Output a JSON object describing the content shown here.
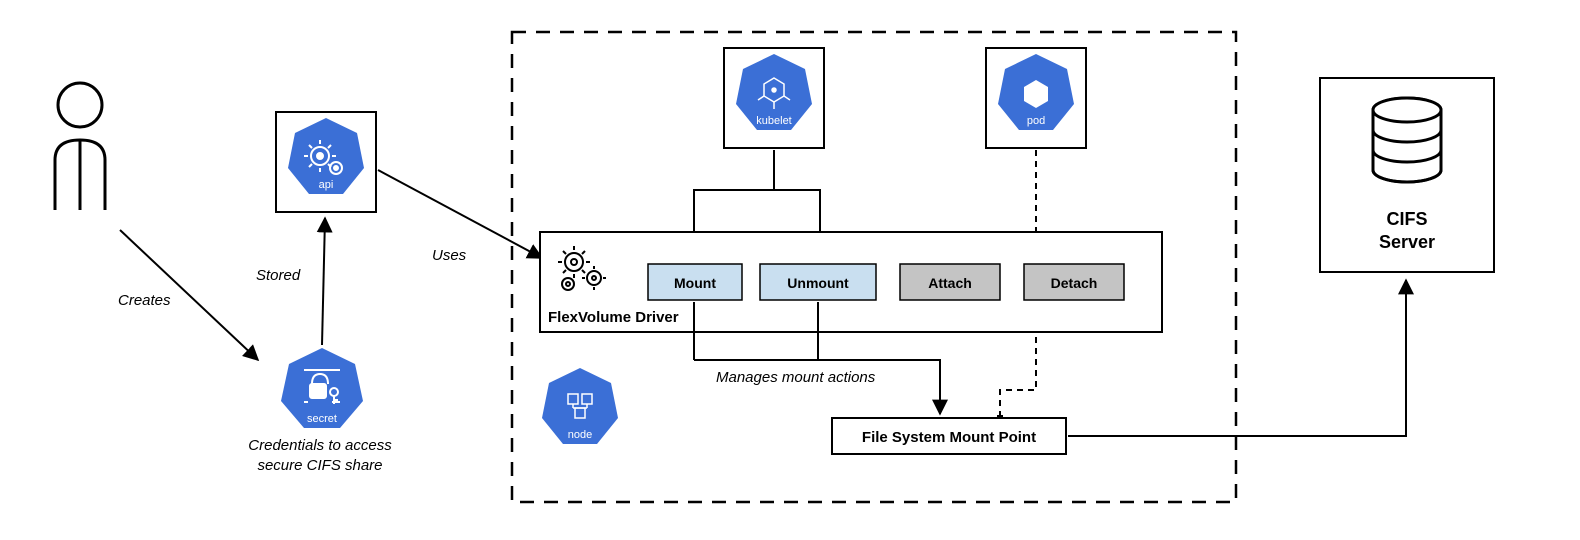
{
  "edges": {
    "creates": "Creates",
    "stored": "Stored",
    "uses": "Uses",
    "manages": "Manages mount actions"
  },
  "components": {
    "api": "api",
    "secret": "secret",
    "kubelet": "kubelet",
    "pod": "pod",
    "node": "node"
  },
  "driver": {
    "title": "FlexVolume Driver",
    "mount": "Mount",
    "unmount": "Unmount",
    "attach": "Attach",
    "detach": "Detach"
  },
  "mountpoint": "File System Mount Point",
  "secret_caption_l1": "Credentials to access",
  "secret_caption_l2": "secure CIFS share",
  "cifs_l1": "CIFS",
  "cifs_l2": "Server"
}
